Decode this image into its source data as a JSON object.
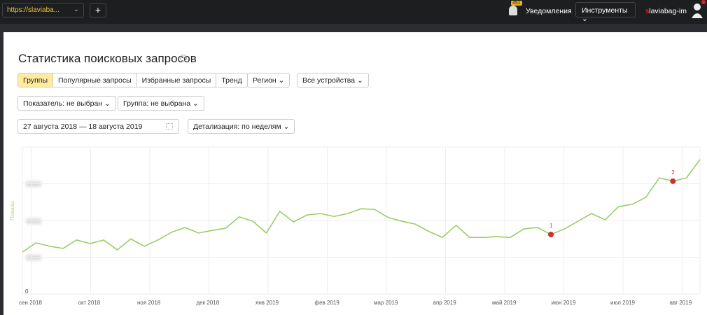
{
  "topbar": {
    "site": "https://slaviaba...",
    "add": "+",
    "notif_count": "451",
    "notifications": "Уведомления",
    "tools": "Инструменты",
    "user_prefix": "s",
    "user_rest": "laviabag-im"
  },
  "page": {
    "title": "Статистика поисковых запросов",
    "info": "i"
  },
  "tabs": [
    "Группы",
    "Популярные запросы",
    "Избранные запросы",
    "Тренд"
  ],
  "filters": {
    "region": "Регион",
    "devices": "Все устройства",
    "indicator": "Показатель: не выбран",
    "group": "Группа: не выбрана",
    "dates": "27 августа 2018 — 18 августа 2019",
    "detail": "Детализация: по неделям"
  },
  "chart_data": {
    "type": "line",
    "ylabel": "Показы",
    "ylim": [
      0,
      400
    ],
    "yticks_visible": [
      "0"
    ],
    "xticks": [
      "сен 2018",
      "окт 2018",
      "ноя 2018",
      "дек 2018",
      "янв 2019",
      "фев 2019",
      "мар 2019",
      "апр 2019",
      "май 2019",
      "июн 2019",
      "июл 2019",
      "авг 2019"
    ],
    "values": [
      114,
      139,
      130,
      124,
      147,
      137,
      147,
      120,
      150,
      130,
      147,
      168,
      181,
      166,
      173,
      179,
      210,
      198,
      166,
      225,
      196,
      215,
      219,
      211,
      219,
      232,
      230,
      208,
      198,
      190,
      170,
      154,
      187,
      154,
      154,
      156,
      154,
      177,
      181,
      162,
      177,
      198,
      219,
      202,
      238,
      244,
      263,
      316,
      307,
      316,
      366
    ],
    "markers": [
      {
        "index": 39,
        "label": "1"
      },
      {
        "index": 48,
        "label": "2"
      }
    ],
    "line_color": "#9ccc65",
    "marker_color": "#d32f2f"
  }
}
